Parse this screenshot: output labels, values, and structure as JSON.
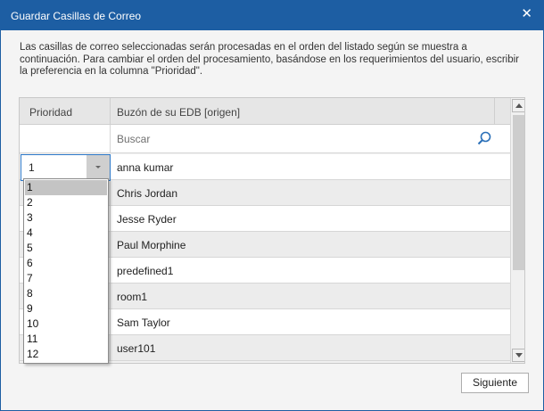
{
  "window": {
    "title": "Guardar Casillas de Correo",
    "close_glyph": "✕"
  },
  "description": "Las casillas de correo seleccionadas serán procesadas en el orden del listado según se muestra a continuación. Para cambiar el orden del procesamiento, basándose en los requerimientos del usuario, escribir la preferencia en la columna \"Prioridad\".",
  "grid": {
    "columns": [
      "Prioridad",
      "Buzón de su EDB [origen]"
    ],
    "search_placeholder": "Buscar",
    "search_icon": "search-icon",
    "selected_priority": "1",
    "rows": [
      {
        "name": "anna kumar"
      },
      {
        "name": "Chris Jordan"
      },
      {
        "name": "Jesse Ryder"
      },
      {
        "name": "Paul Morphine"
      },
      {
        "name": "predefined1"
      },
      {
        "name": "room1"
      },
      {
        "name": "Sam Taylor"
      },
      {
        "name": "user101"
      }
    ]
  },
  "priority_options": [
    "1",
    "2",
    "3",
    "4",
    "5",
    "6",
    "7",
    "8",
    "9",
    "10",
    "11",
    "12"
  ],
  "priority_selected_option": "1",
  "footer": {
    "next_label": "Siguiente"
  },
  "colors": {
    "titlebar": "#1d5ea3",
    "focus_border": "#2d78c8"
  }
}
